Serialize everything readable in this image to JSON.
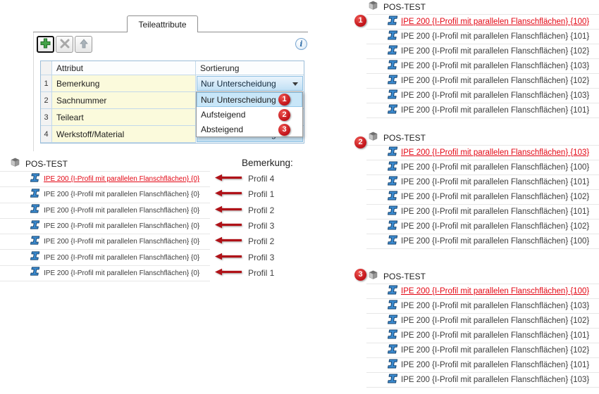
{
  "dialog": {
    "tab_label": "Teileattribute",
    "toolbar": {
      "add": "add",
      "delete": "delete",
      "move_up": "move-up"
    },
    "info_glyph": "i",
    "table": {
      "columns": [
        "Attribut",
        "Sortierung"
      ],
      "rows": [
        {
          "num": "1",
          "attribut": "Bemerkung",
          "sortierung": "Nur Unterscheidung"
        },
        {
          "num": "2",
          "attribut": "Sachnummer",
          "sortierung": ""
        },
        {
          "num": "3",
          "attribut": "Teileart",
          "sortierung": ""
        },
        {
          "num": "4",
          "attribut": "Werkstoff/Material",
          "sortierung": "Nur Unterscheidung"
        }
      ]
    },
    "dropdown_items": [
      {
        "label": "Nur Unterscheidung",
        "badge": "1"
      },
      {
        "label": "Aufsteigend",
        "badge": "2"
      },
      {
        "label": "Absteigend",
        "badge": "3"
      }
    ]
  },
  "left_tree": {
    "root": "POS-TEST",
    "items": [
      "IPE 200 {I-Profil mit parallelen Flanschflächen} {0}",
      "IPE 200 {I-Profil mit parallelen Flanschflächen} {0}",
      "IPE 200 {I-Profil mit parallelen Flanschflächen} {0}",
      "IPE 200 {I-Profil mit parallelen Flanschflächen} {0}",
      "IPE 200 {I-Profil mit parallelen Flanschflächen} {0}",
      "IPE 200 {I-Profil mit parallelen Flanschflächen} {0}",
      "IPE 200 {I-Profil mit parallelen Flanschflächen} {0}"
    ],
    "annotation_title": "Bemerkung:",
    "annotations": [
      "Profil 4",
      "Profil 1",
      "Profil 2",
      "Profil 3",
      "Profil 2",
      "Profil 3",
      "Profil 1"
    ]
  },
  "result_trees": [
    {
      "badge": "1",
      "root": "POS-TEST",
      "items": [
        "IPE 200 {I-Profil mit parallelen Flanschflächen} {100}",
        "IPE 200 {I-Profil mit parallelen Flanschflächen} {101}",
        "IPE 200 {I-Profil mit parallelen Flanschflächen} {102}",
        "IPE 200 {I-Profil mit parallelen Flanschflächen} {103}",
        "IPE 200 {I-Profil mit parallelen Flanschflächen} {102}",
        "IPE 200 {I-Profil mit parallelen Flanschflächen} {103}",
        "IPE 200 {I-Profil mit parallelen Flanschflächen} {101}"
      ]
    },
    {
      "badge": "2",
      "root": "POS-TEST",
      "items": [
        "IPE 200 {I-Profil mit parallelen Flanschflächen} {103}",
        "IPE 200 {I-Profil mit parallelen Flanschflächen} {100}",
        "IPE 200 {I-Profil mit parallelen Flanschflächen} {101}",
        "IPE 200 {I-Profil mit parallelen Flanschflächen} {102}",
        "IPE 200 {I-Profil mit parallelen Flanschflächen} {101}",
        "IPE 200 {I-Profil mit parallelen Flanschflächen} {102}",
        "IPE 200 {I-Profil mit parallelen Flanschflächen} {100}"
      ]
    },
    {
      "badge": "3",
      "root": "POS-TEST",
      "items": [
        "IPE 200 {I-Profil mit parallelen Flanschflächen} {100}",
        "IPE 200 {I-Profil mit parallelen Flanschflächen} {103}",
        "IPE 200 {I-Profil mit parallelen Flanschflächen} {102}",
        "IPE 200 {I-Profil mit parallelen Flanschflächen} {101}",
        "IPE 200 {I-Profil mit parallelen Flanschflächen} {102}",
        "IPE 200 {I-Profil mit parallelen Flanschflächen} {101}",
        "IPE 200 {I-Profil mit parallelen Flanschflächen} {103}"
      ]
    }
  ]
}
